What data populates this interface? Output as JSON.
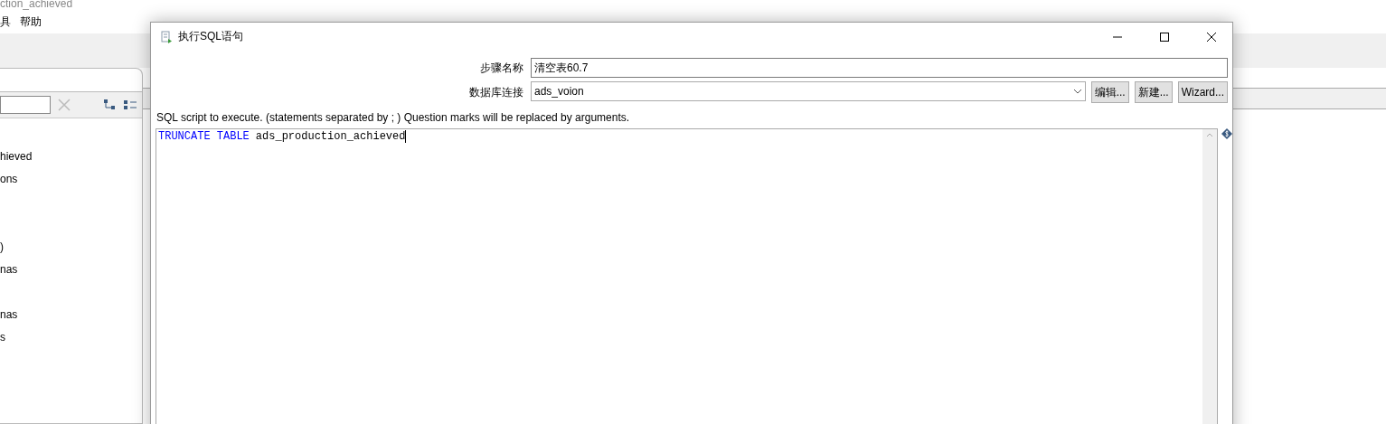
{
  "background_app": {
    "title": "ction_achieved",
    "menu": [
      "具",
      "帮助"
    ],
    "tree_items": [
      {
        "label": "hieved"
      },
      {
        "label": "ons"
      },
      {
        "label": ")"
      },
      {
        "label": "nas"
      },
      {
        "label": "nas"
      },
      {
        "label": "s"
      }
    ]
  },
  "dialog": {
    "title": "执行SQL语句",
    "fields": [
      {
        "kind": "text",
        "label": "步骤名称",
        "value": "清空表60.7"
      },
      {
        "kind": "combo",
        "label": "数据库连接",
        "value": "ads_voion",
        "buttons": [
          "编辑...",
          "新建...",
          "Wizard..."
        ]
      }
    ],
    "sql_label": "SQL script to execute. (statements separated by ; ) Question marks will be replaced by arguments.",
    "sql": [
      {
        "kind": "keyword",
        "text": "TRUNCATE TABLE"
      },
      {
        "kind": "plain",
        "text": "ads_production_achieved"
      }
    ]
  }
}
